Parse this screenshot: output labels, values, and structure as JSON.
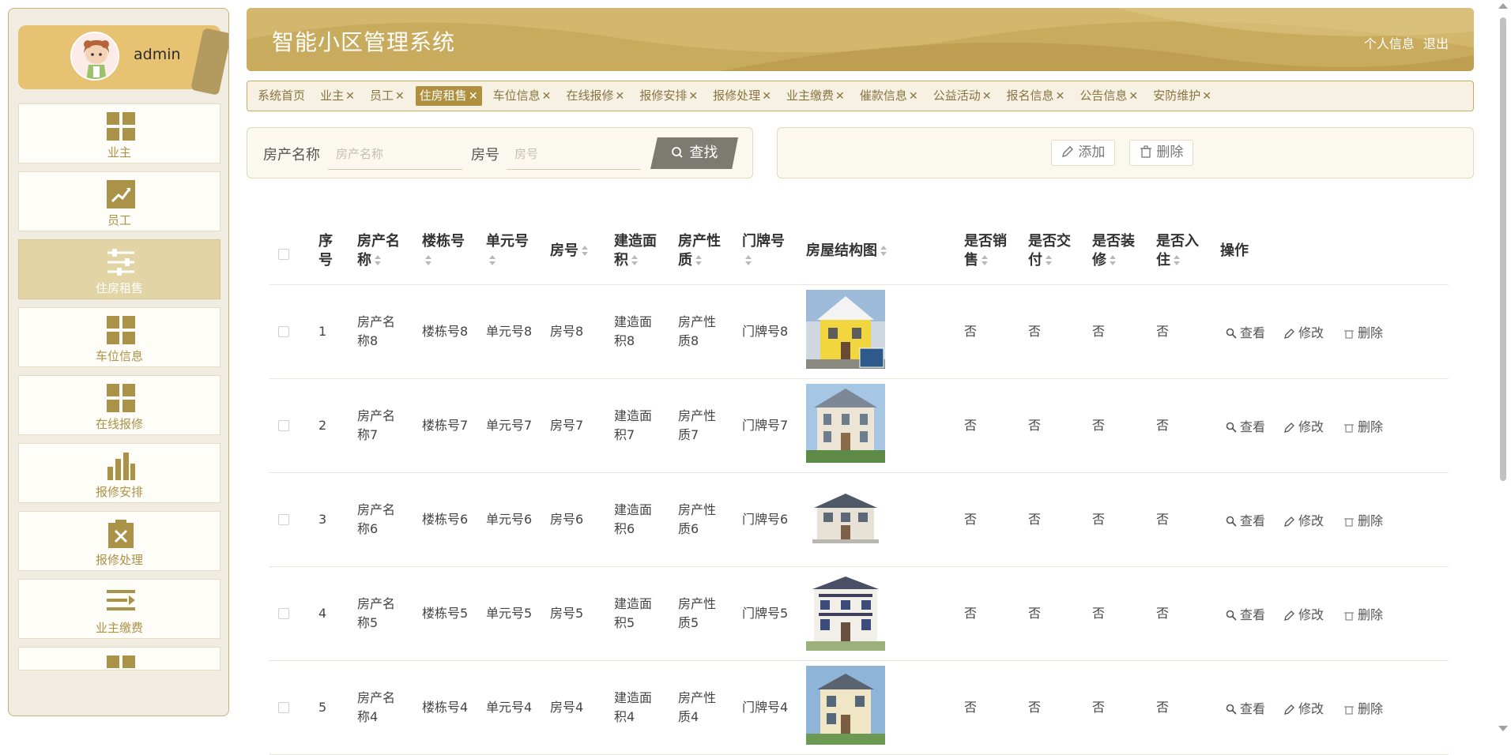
{
  "user": {
    "name": "admin"
  },
  "sidebar": {
    "items": [
      {
        "label": "业主",
        "icon": "grid-icon",
        "active": false
      },
      {
        "label": "员工",
        "icon": "chart-line-icon",
        "active": false
      },
      {
        "label": "住房租售",
        "icon": "sliders-icon",
        "active": true
      },
      {
        "label": "车位信息",
        "icon": "grid-icon",
        "active": false
      },
      {
        "label": "在线报修",
        "icon": "grid-icon",
        "active": false
      },
      {
        "label": "报修安排",
        "icon": "bar-chart-icon",
        "active": false
      },
      {
        "label": "报修处理",
        "icon": "clipboard-x-icon",
        "active": false
      },
      {
        "label": "业主缴费",
        "icon": "list-arrow-icon",
        "active": false
      }
    ]
  },
  "header": {
    "title": "智能小区管理系统",
    "profile_link": "个人信息",
    "logout_link": "退出"
  },
  "tabs": [
    {
      "label": "系统首页",
      "closable": false,
      "active": false
    },
    {
      "label": "业主",
      "closable": true,
      "active": false
    },
    {
      "label": "员工",
      "closable": true,
      "active": false
    },
    {
      "label": "住房租售",
      "closable": true,
      "active": true
    },
    {
      "label": "车位信息",
      "closable": true,
      "active": false
    },
    {
      "label": "在线报修",
      "closable": true,
      "active": false
    },
    {
      "label": "报修安排",
      "closable": true,
      "active": false
    },
    {
      "label": "报修处理",
      "closable": true,
      "active": false
    },
    {
      "label": "业主缴费",
      "closable": true,
      "active": false
    },
    {
      "label": "催款信息",
      "closable": true,
      "active": false
    },
    {
      "label": "公益活动",
      "closable": true,
      "active": false
    },
    {
      "label": "报名信息",
      "closable": true,
      "active": false
    },
    {
      "label": "公告信息",
      "closable": true,
      "active": false
    },
    {
      "label": "安防维护",
      "closable": true,
      "active": false
    }
  ],
  "tab_close_glyph": "✕",
  "search": {
    "name_label": "房产名称",
    "name_placeholder": "房产名称",
    "name_value": "",
    "room_label": "房号",
    "room_placeholder": "房号",
    "room_value": "",
    "button_label": "查找"
  },
  "actions": {
    "add_label": "添加",
    "delete_label": "删除"
  },
  "table": {
    "columns": [
      {
        "label": "序号",
        "sortable": false
      },
      {
        "label": "房产名称",
        "sortable": true
      },
      {
        "label": "楼栋号",
        "sortable": true
      },
      {
        "label": "单元号",
        "sortable": true
      },
      {
        "label": "房号",
        "sortable": true
      },
      {
        "label": "建造面积",
        "sortable": true
      },
      {
        "label": "房产性质",
        "sortable": true
      },
      {
        "label": "门牌号",
        "sortable": true
      },
      {
        "label": "房屋结构图",
        "sortable": true
      },
      {
        "label": "是否销售",
        "sortable": true
      },
      {
        "label": "是否交付",
        "sortable": true
      },
      {
        "label": "是否装修",
        "sortable": true
      },
      {
        "label": "是否入住",
        "sortable": true
      },
      {
        "label": "操作",
        "sortable": false
      }
    ],
    "rows": [
      {
        "index": "1",
        "name": "房产名称8",
        "building": "楼栋号8",
        "unit": "单元号8",
        "room": "房号8",
        "area": "建造面积8",
        "nature": "房产性质8",
        "door": "门牌号8",
        "sold": "否",
        "delivered": "否",
        "decorated": "否",
        "occupied": "否"
      },
      {
        "index": "2",
        "name": "房产名称7",
        "building": "楼栋号7",
        "unit": "单元号7",
        "room": "房号7",
        "area": "建造面积7",
        "nature": "房产性质7",
        "door": "门牌号7",
        "sold": "否",
        "delivered": "否",
        "decorated": "否",
        "occupied": "否"
      },
      {
        "index": "3",
        "name": "房产名称6",
        "building": "楼栋号6",
        "unit": "单元号6",
        "room": "房号6",
        "area": "建造面积6",
        "nature": "房产性质6",
        "door": "门牌号6",
        "sold": "否",
        "delivered": "否",
        "decorated": "否",
        "occupied": "否"
      },
      {
        "index": "4",
        "name": "房产名称5",
        "building": "楼栋号5",
        "unit": "单元号5",
        "room": "房号5",
        "area": "建造面积5",
        "nature": "房产性质5",
        "door": "门牌号5",
        "sold": "否",
        "delivered": "否",
        "decorated": "否",
        "occupied": "否"
      },
      {
        "index": "5",
        "name": "房产名称4",
        "building": "楼栋号4",
        "unit": "单元号4",
        "room": "房号4",
        "area": "建造面积4",
        "nature": "房产性质4",
        "door": "门牌号4",
        "sold": "否",
        "delivered": "否",
        "decorated": "否",
        "occupied": "否"
      }
    ],
    "ops": {
      "view": "查看",
      "edit": "修改",
      "delete": "删除"
    }
  },
  "colors": {
    "brand": "#c8ab5c",
    "brand_dark": "#b08f3f",
    "active_menu": "#e3d4a5",
    "menu_label": "#ab9249",
    "search_button": "#7d7a72"
  }
}
